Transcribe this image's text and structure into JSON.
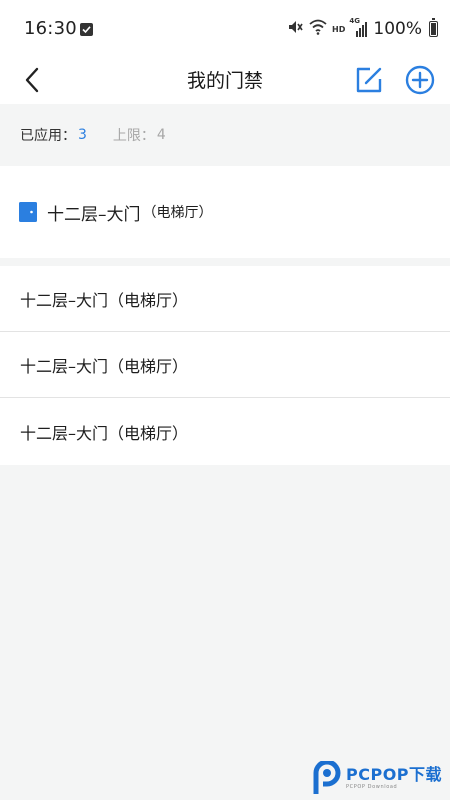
{
  "status_bar": {
    "time": "16:30",
    "network_label": "HD",
    "signal_label": "4G",
    "battery": "100%"
  },
  "header": {
    "title": "我的门禁"
  },
  "summary": {
    "applied_label": "已应用：",
    "applied_value": "3",
    "limit_label": "上限：",
    "limit_value": "4"
  },
  "current_door": {
    "name": "十二层–大门",
    "location": "（电梯厅）",
    "icon": "door-icon"
  },
  "door_list": [
    {
      "label": "十二层–大门（电梯厅）"
    },
    {
      "label": "十二层–大门（电梯厅）"
    },
    {
      "label": "十二层–大门（电梯厅）"
    }
  ],
  "watermark": {
    "main": "PCPOP下载",
    "sub": "PCPOP Download"
  },
  "colors": {
    "accent": "#2b7fe0",
    "background": "#f4f5f5",
    "card": "#ffffff",
    "muted": "#a7a7a7"
  }
}
